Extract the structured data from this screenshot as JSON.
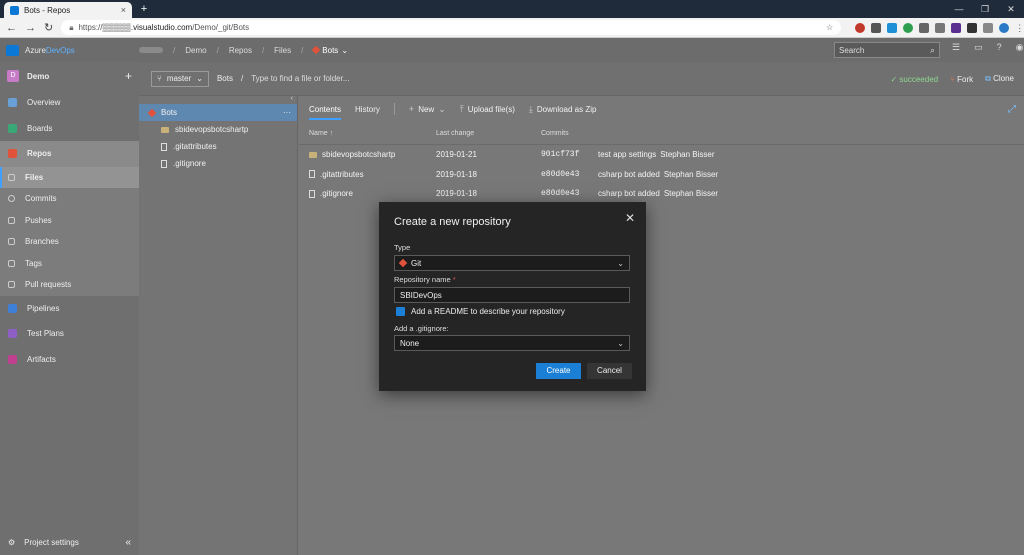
{
  "browser": {
    "tab_title": "Bots - Repos",
    "tab_close": "×",
    "new_tab": "+",
    "window_controls": [
      "—",
      "❐",
      "✕"
    ],
    "url_prefix": "https://",
    "url_host": "▒▒▒▒▒.visualstudio.com",
    "url_path": "/Demo/_git/Bots"
  },
  "header": {
    "brand_a": "Azure ",
    "brand_b": "DevOps",
    "breadcrumbs": [
      "Demo",
      "Repos",
      "Files"
    ],
    "repo_name": "Bots",
    "search_placeholder": "Search"
  },
  "sidebar": {
    "project_initial": "D",
    "project_name": "Demo",
    "items": [
      {
        "label": "Overview",
        "color": "#6aa0d8"
      },
      {
        "label": "Boards",
        "color": "#3aa776"
      },
      {
        "label": "Repos",
        "color": "#e0533a"
      },
      {
        "label": "Files"
      },
      {
        "label": "Commits"
      },
      {
        "label": "Pushes"
      },
      {
        "label": "Branches"
      },
      {
        "label": "Tags"
      },
      {
        "label": "Pull requests"
      },
      {
        "label": "Pipelines",
        "color": "#3e7fd8"
      },
      {
        "label": "Test Plans",
        "color": "#8f5fc8"
      },
      {
        "label": "Artifacts",
        "color": "#c04090"
      }
    ],
    "settings_label": "Project settings"
  },
  "pathbar": {
    "branch": "master",
    "repo": "Bots",
    "path_placeholder": "Type to find a file or folder...",
    "status": "succeeded",
    "fork": "Fork",
    "clone": "Clone"
  },
  "tree": {
    "root": "Bots",
    "children": [
      {
        "name": "sbidevopsbotcshartp",
        "kind": "folder"
      },
      {
        "name": ".gitattributes",
        "kind": "file"
      },
      {
        "name": ".gitignore",
        "kind": "file"
      }
    ]
  },
  "content": {
    "tabs": [
      "Contents",
      "History"
    ],
    "actions": {
      "new": "New",
      "upload": "Upload file(s)",
      "download": "Download as Zip"
    },
    "columns": {
      "name": "Name ↑",
      "last_change": "Last change",
      "commits": "Commits"
    },
    "rows": [
      {
        "name": "sbidevopsbotcshartp",
        "kind": "folder",
        "date": "2019-01-21",
        "commit": "901cf73f",
        "message": "test app settings",
        "author": "Stephan Bisser"
      },
      {
        "name": ".gitattributes",
        "kind": "file",
        "date": "2019-01-18",
        "commit": "e80d0e43",
        "message": "csharp bot added",
        "author": "Stephan Bisser"
      },
      {
        "name": ".gitignore",
        "kind": "file",
        "date": "2019-01-18",
        "commit": "e80d0e43",
        "message": "csharp bot added",
        "author": "Stephan Bisser"
      }
    ]
  },
  "dialog": {
    "title": "Create a new repository",
    "type_label": "Type",
    "type_value": "Git",
    "name_label": "Repository name",
    "name_required": "*",
    "name_value": "SBIDevOps",
    "readme_label": "Add a README to describe your repository",
    "readme_checked": true,
    "gitignore_label": "Add a .gitignore:",
    "gitignore_value": "None",
    "create": "Create",
    "cancel": "Cancel"
  }
}
